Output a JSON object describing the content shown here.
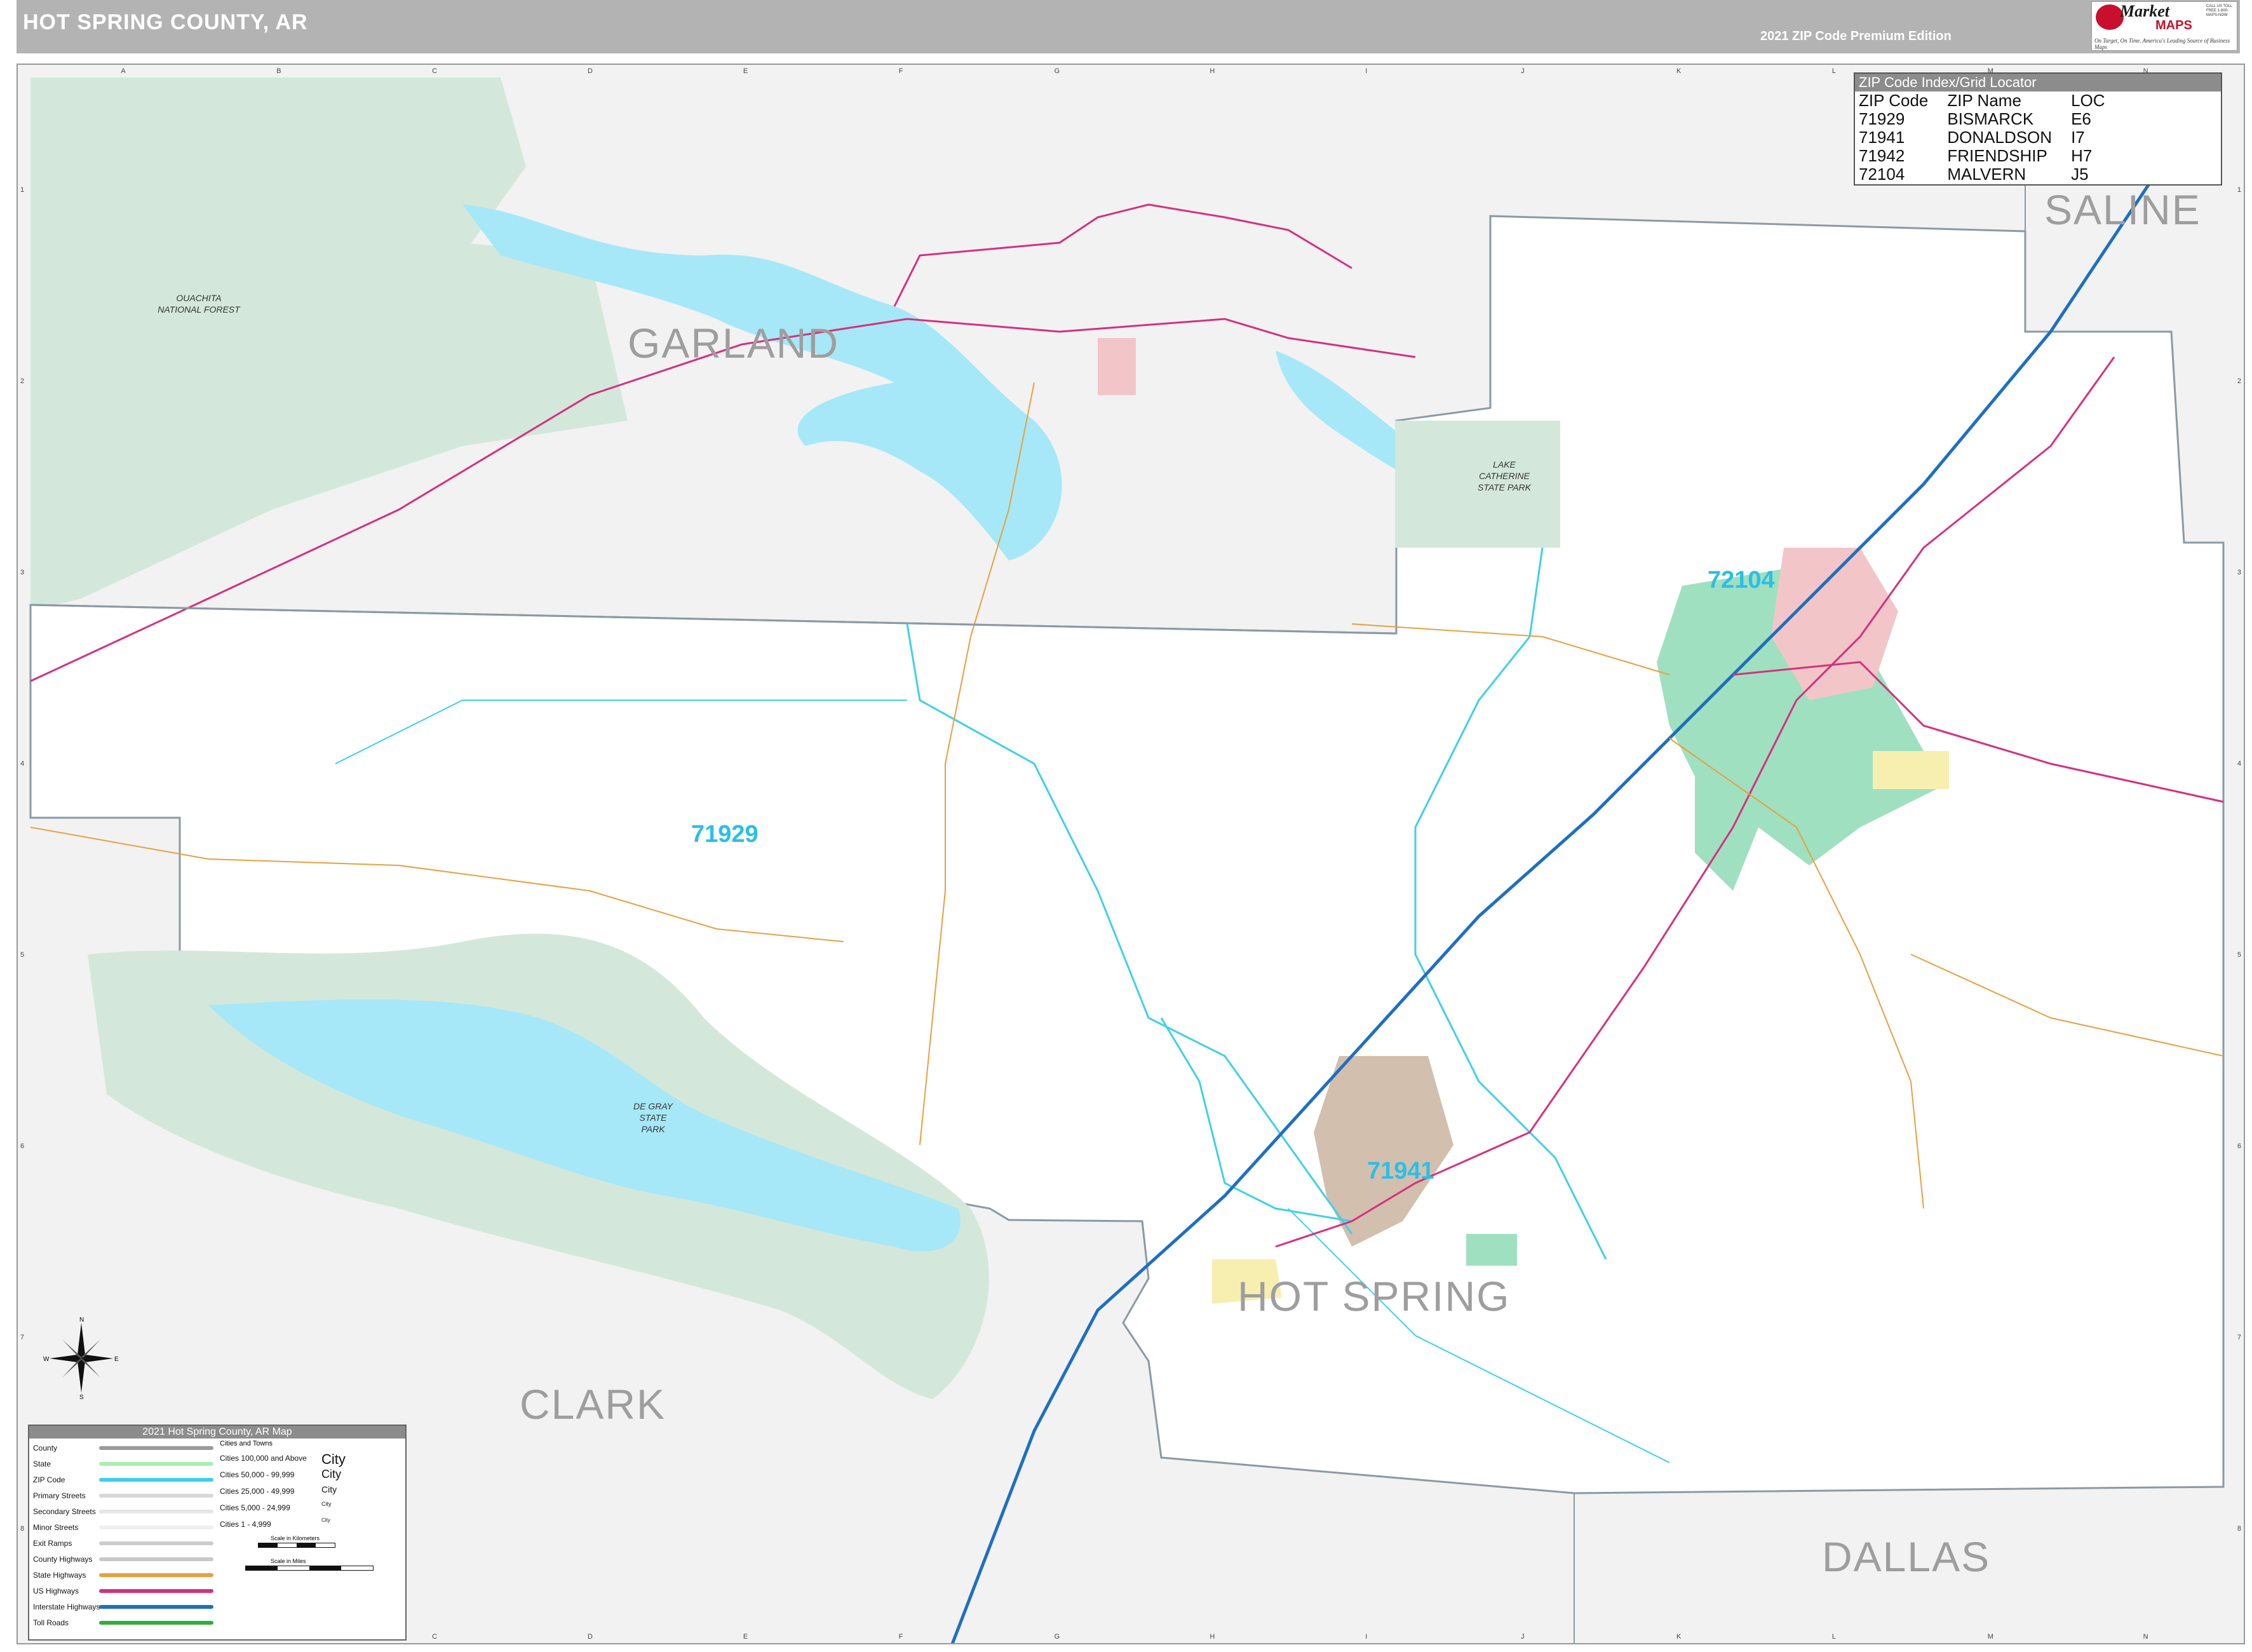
{
  "header": {
    "title": "HOT SPRING COUNTY, AR",
    "edition": "2021 ZIP Code Premium Edition",
    "logo": {
      "brand_top": "Market",
      "brand_bottom": "MAPS",
      "tagline": "On Target, On Time. America's Leading Source of Business Maps",
      "phone": "CALL US TOLL FREE 1-800-MAPS-NOW"
    }
  },
  "grid": {
    "letters": [
      "A",
      "B",
      "C",
      "D",
      "E",
      "F",
      "G",
      "H",
      "I",
      "J",
      "K",
      "L",
      "M",
      "N"
    ],
    "numbers": [
      "1",
      "2",
      "3",
      "4",
      "5",
      "6",
      "7",
      "8"
    ]
  },
  "counties": {
    "garland": "GARLAND",
    "saline": "SALINE",
    "clark": "CLARK",
    "hot_spring": "HOT SPRING",
    "dallas": "DALLAS"
  },
  "zips": {
    "z72104": "72104",
    "z71929": "71929",
    "z71941": "71941"
  },
  "parks": {
    "ouachita": "OUACHITA NATIONAL FOREST",
    "lake_catherine": "LAKE CATHERINE STATE PARK",
    "degray": "DE GRAY STATE PARK"
  },
  "zip_index": {
    "title": "ZIP Code Index/Grid Locator",
    "headers": [
      "ZIP Code",
      "ZIP Name",
      "LOC"
    ],
    "rows": [
      [
        "71929",
        "BISMARCK",
        "E6"
      ],
      [
        "71941",
        "DONALDSON",
        "I7"
      ],
      [
        "71942",
        "FRIENDSHIP",
        "H7"
      ],
      [
        "72104",
        "MALVERN",
        "J5"
      ]
    ]
  },
  "legend": {
    "title": "2021 Hot Spring County, AR Map",
    "cities_header": "Cities and Towns",
    "items": [
      {
        "label": "County",
        "color": "#9a9a9a"
      },
      {
        "label": "State",
        "color": "#a8f0b0"
      },
      {
        "label": "ZIP Code",
        "color": "#40d0e8"
      },
      {
        "label": "Primary Streets",
        "color": "#d8d8d8"
      },
      {
        "label": "Secondary Streets",
        "color": "#e6e6e6"
      },
      {
        "label": "Minor Streets",
        "color": "#efefef"
      },
      {
        "label": "Exit Ramps",
        "color": "#cccccc"
      },
      {
        "label": "County Highways",
        "color": "#c8c8c8"
      },
      {
        "label": "State Highways",
        "color": "#e8a040"
      },
      {
        "label": "US Highways",
        "color": "#d6307e"
      },
      {
        "label": "Interstate Highways",
        "color": "#1f6fc0"
      },
      {
        "label": "Toll Roads",
        "color": "#2fae3a"
      }
    ],
    "cities": [
      {
        "label": "Cities 100,000 and Above",
        "sample": "City"
      },
      {
        "label": "Cities 50,000 - 99,999",
        "sample": "City"
      },
      {
        "label": "Cities 25,000 - 49,999",
        "sample": "City"
      },
      {
        "label": "Cities 5,000 - 24,999",
        "sample": "City"
      },
      {
        "label": "Cities 1 - 4,999",
        "sample": "City"
      }
    ],
    "scale_km": "Scale in Kilometers",
    "scale_mi": "Scale in Miles"
  },
  "compass": {
    "n": "N",
    "s": "S",
    "e": "E",
    "w": "W"
  },
  "colors": {
    "outside_county": "#f2f2f2",
    "forest": "#d3e8da",
    "water": "#a6e8f7",
    "interstate": "#1f6fc0",
    "us_highway": "#d6307e",
    "state_highway": "#e8a040",
    "zip_boundary": "#40d0e8",
    "county_boundary": "#8a9aa6",
    "city_green": "#9fe0c0",
    "city_pink": "#f2c6c8",
    "city_tan": "#d2bfae",
    "city_yellow": "#f6efb0"
  }
}
